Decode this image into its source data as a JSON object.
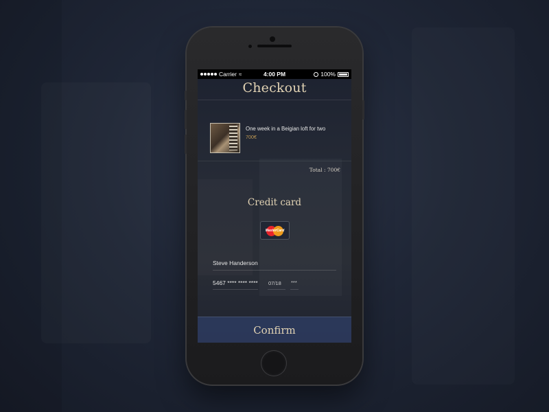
{
  "status_bar": {
    "carrier": "Carrier",
    "wifi_icon": "wifi-icon",
    "time": "4:00 PM",
    "battery": "100%"
  },
  "checkout": {
    "title": "Checkout",
    "item": {
      "name": "One week in a Beigian loft for two",
      "price": "700€",
      "thumbnail": "loft-photo"
    },
    "total": "Total : 700€"
  },
  "payment": {
    "title": "Credit card",
    "card_brand_icon": "mastercard-icon",
    "card_brand_text": "MasterCard",
    "cardholder": "Steve Handerson",
    "card_number": "5467 **** **** ****",
    "expiry": "07/18",
    "cvv": "***"
  },
  "actions": {
    "confirm_label": "Confirm"
  },
  "colors": {
    "accent_gold": "#e2d3b4",
    "price": "#c19a54",
    "confirm_bg": "#2c3a5c"
  }
}
